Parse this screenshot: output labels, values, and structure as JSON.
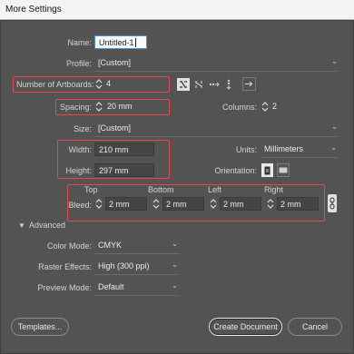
{
  "window": {
    "title": "More Settings"
  },
  "name": {
    "label": "Name:",
    "value": "Untitled-1"
  },
  "profile": {
    "label": "Profile:",
    "value": "[Custom]"
  },
  "artboards": {
    "label": "Number of Artboards:",
    "value": "4"
  },
  "spacing": {
    "label": "Spacing:",
    "value": "20 mm"
  },
  "columns": {
    "label": "Columns:",
    "value": "2"
  },
  "size": {
    "label": "Size:",
    "value": "[Custom]"
  },
  "width": {
    "label": "Width:",
    "value": "210 mm"
  },
  "height": {
    "label": "Height:",
    "value": "297 mm"
  },
  "units": {
    "label": "Units:",
    "value": "Millimeters"
  },
  "orientation": {
    "label": "Orientation:"
  },
  "bleed": {
    "label": "Bleed:",
    "top_label": "Top",
    "top": "2 mm",
    "bottom_label": "Bottom",
    "bottom": "2 mm",
    "left_label": "Left",
    "left": "2 mm",
    "right_label": "Right",
    "right": "2 mm"
  },
  "advanced": {
    "header": "Advanced",
    "color_mode_label": "Color Mode:",
    "color_mode": "CMYK",
    "raster_label": "Raster Effects:",
    "raster": "High (300 ppi)",
    "preview_label": "Preview Mode:",
    "preview": "Default"
  },
  "footer": {
    "templates": "Templates...",
    "create": "Create Document",
    "cancel": "Cancel"
  },
  "colors": {
    "highlight": "#e5484d",
    "panel": "#535353"
  }
}
